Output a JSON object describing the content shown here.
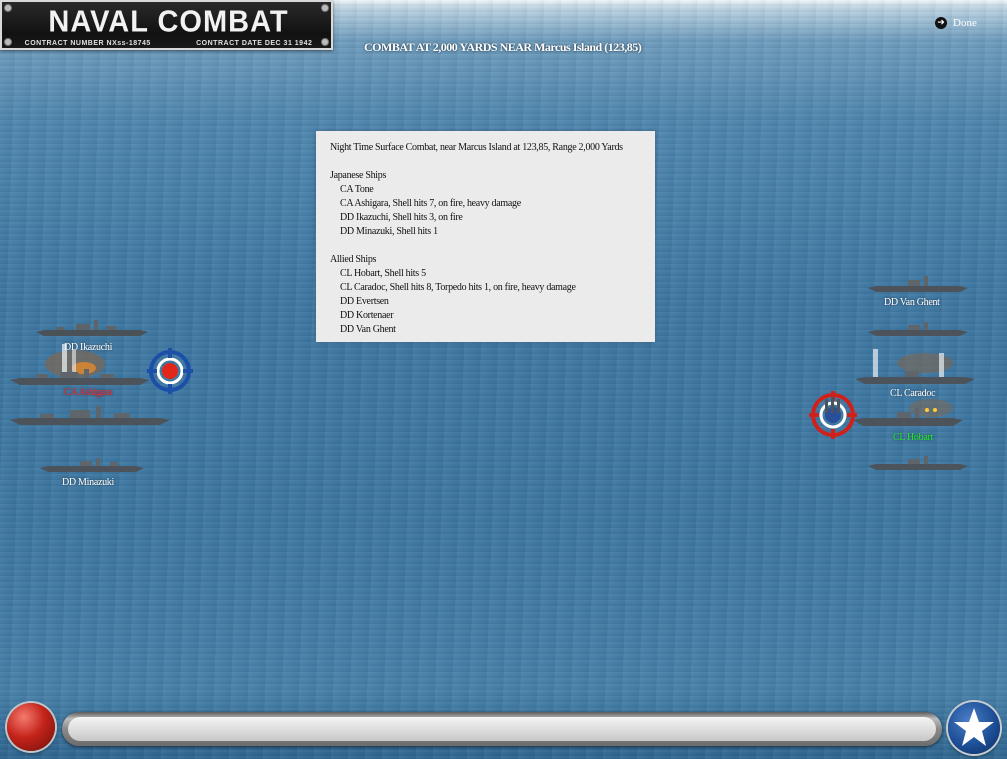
{
  "title_plaque": {
    "title": "NAVAL COMBAT",
    "contract_number": "CONTRACT NUMBER  NXss-18745",
    "contract_date": "CONTRACT DATE  DEC 31 1942"
  },
  "header": {
    "combat_text": "COMBAT AT 2,000 YARDS NEAR Marcus Island (123,85)"
  },
  "done_button": {
    "label": "Done",
    "icon": "arrow-right-circle-icon"
  },
  "report": {
    "headline": "Night Time Surface Combat, near Marcus Island at 123,85, Range 2,000 Yards",
    "japanese_heading": "Japanese Ships",
    "japanese_ships": [
      "CA Tone",
      "CA Ashigara, Shell hits 7,  on fire,  heavy damage",
      "DD Ikazuchi, Shell hits 3,  on fire",
      "DD Minazuki, Shell hits 1"
    ],
    "allied_heading": "Allied Ships",
    "allied_ships": [
      "CL Hobart, Shell hits 5",
      "CL Caradoc, Shell hits 8, Torpedo hits 1,  on fire,  heavy damage",
      "DD Evertsen",
      "DD Kortenaer",
      "DD Van Ghent"
    ]
  },
  "map_labels": {
    "jp_ikazuchi": "DD Ikazuchi",
    "jp_ashigara": "CA Ashigara",
    "jp_minazuki": "DD Minazuki",
    "al_van_ghent": "DD Van Ghent",
    "al_caradoc": "CL Caradoc",
    "al_hobart": "CL Hobart"
  },
  "colors": {
    "target_label_red": "#ff2a2a",
    "target_label_green": "#22ee22",
    "report_bg": "#ebebeb"
  }
}
